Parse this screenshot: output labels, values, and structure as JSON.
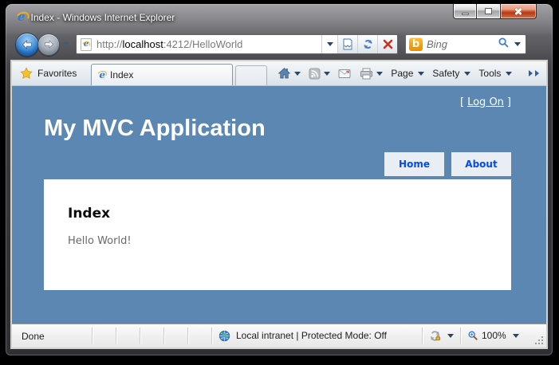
{
  "window": {
    "title": "Index - Windows Internet Explorer"
  },
  "navbar": {
    "url": {
      "scheme": "http://",
      "domain": "localhost",
      "rest": ":4212/HelloWorld"
    },
    "search_placeholder": "Bing",
    "bing_letter": "b",
    "ie_letter": "e"
  },
  "toolbar": {
    "favorites_label": "Favorites",
    "tab_title": "Index",
    "page_label": "Page",
    "safety_label": "Safety",
    "tools_label": "Tools"
  },
  "page": {
    "logon_open": "[",
    "logon_link": "Log On",
    "logon_close": "]",
    "site_title": "My MVC Application",
    "tabs": [
      {
        "label": "Home"
      },
      {
        "label": "About"
      }
    ],
    "heading": "Index",
    "body_text": "Hello World!",
    "colors": {
      "background": "#5c87b2",
      "menu_bg": "#e8eef4",
      "menu_text": "#034af3",
      "title_text": "#ffffff"
    }
  },
  "statusbar": {
    "status": "Done",
    "zone_text": "Local intranet | Protected Mode: Off",
    "zoom_level": "100%"
  }
}
